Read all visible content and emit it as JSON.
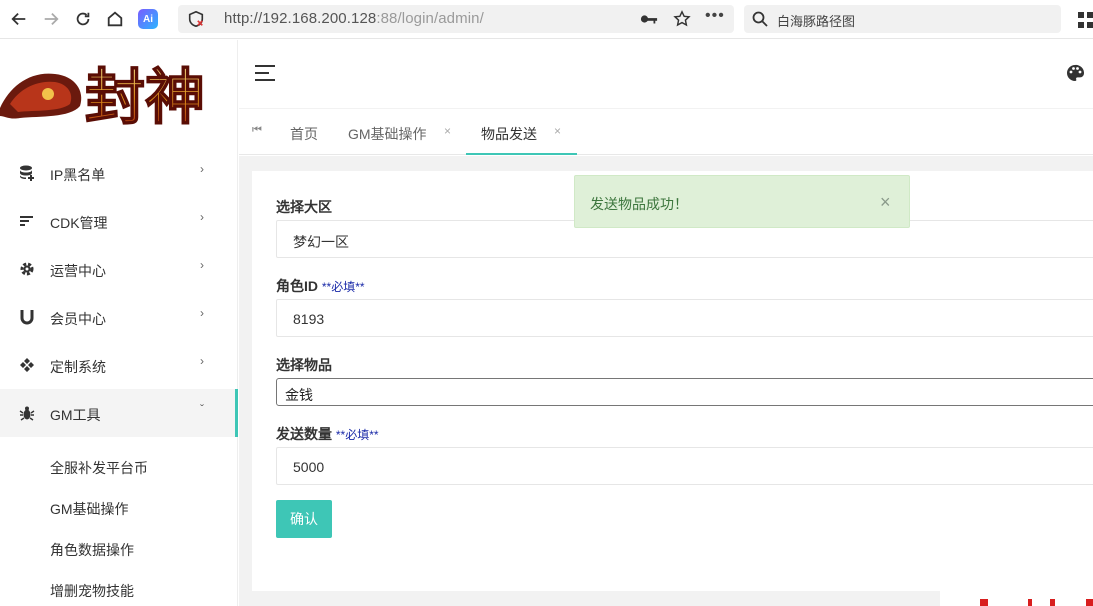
{
  "browser": {
    "url_main": "http://192.168.200.128",
    "url_rest": ":88/login/admin/",
    "search_text": "白海豚路径图",
    "ai_label": "Ai"
  },
  "sidebar": {
    "logo_text": "封神",
    "menu": [
      {
        "label": "IP黑名单",
        "icon": "database-add-icon",
        "arrow": "›"
      },
      {
        "label": "CDK管理",
        "icon": "sort-lines-icon",
        "arrow": "›"
      },
      {
        "label": "运营中心",
        "icon": "gear-icon",
        "arrow": "›"
      },
      {
        "label": "会员中心",
        "icon": "magnet-icon",
        "arrow": "›"
      },
      {
        "label": "定制系统",
        "icon": "diamond-grid-icon",
        "arrow": "›"
      },
      {
        "label": "GM工具",
        "icon": "bug-icon",
        "arrow": "ˇ"
      }
    ],
    "submenu": [
      "全服补发平台币",
      "GM基础操作",
      "角色数据操作",
      "增删宠物技能"
    ]
  },
  "tabs": {
    "first_icon": "⏮",
    "items": [
      {
        "label": "首页",
        "closable": false
      },
      {
        "label": "GM基础操作",
        "closable": true
      },
      {
        "label": "物品发送",
        "closable": true
      }
    ],
    "close_glyph": "×"
  },
  "form": {
    "zone_label": "选择大区",
    "zone_value": "梦幻一区",
    "role_label": "角色ID",
    "role_required": "**必填**",
    "role_value": "8193",
    "item_label": "选择物品",
    "item_value": "金钱",
    "qty_label": "发送数量",
    "qty_required": "**必填**",
    "qty_value": "5000",
    "confirm_label": "确认"
  },
  "toast": {
    "message": "发送物品成功！",
    "close_glyph": "×"
  },
  "colors": {
    "accent": "#3ec6b6",
    "toast_bg": "#dff0d8",
    "toast_text": "#3c763d",
    "required": "#1a2aa8"
  }
}
